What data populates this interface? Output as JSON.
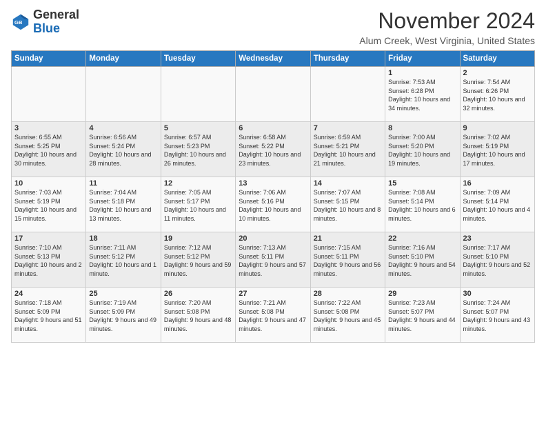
{
  "header": {
    "logo_general": "General",
    "logo_blue": "Blue",
    "title": "November 2024",
    "location": "Alum Creek, West Virginia, United States"
  },
  "days_of_week": [
    "Sunday",
    "Monday",
    "Tuesday",
    "Wednesday",
    "Thursday",
    "Friday",
    "Saturday"
  ],
  "weeks": [
    [
      {
        "day": "",
        "info": ""
      },
      {
        "day": "",
        "info": ""
      },
      {
        "day": "",
        "info": ""
      },
      {
        "day": "",
        "info": ""
      },
      {
        "day": "",
        "info": ""
      },
      {
        "day": "1",
        "info": "Sunrise: 7:53 AM\nSunset: 6:28 PM\nDaylight: 10 hours and 34 minutes."
      },
      {
        "day": "2",
        "info": "Sunrise: 7:54 AM\nSunset: 6:26 PM\nDaylight: 10 hours and 32 minutes."
      }
    ],
    [
      {
        "day": "3",
        "info": "Sunrise: 6:55 AM\nSunset: 5:25 PM\nDaylight: 10 hours and 30 minutes."
      },
      {
        "day": "4",
        "info": "Sunrise: 6:56 AM\nSunset: 5:24 PM\nDaylight: 10 hours and 28 minutes."
      },
      {
        "day": "5",
        "info": "Sunrise: 6:57 AM\nSunset: 5:23 PM\nDaylight: 10 hours and 26 minutes."
      },
      {
        "day": "6",
        "info": "Sunrise: 6:58 AM\nSunset: 5:22 PM\nDaylight: 10 hours and 23 minutes."
      },
      {
        "day": "7",
        "info": "Sunrise: 6:59 AM\nSunset: 5:21 PM\nDaylight: 10 hours and 21 minutes."
      },
      {
        "day": "8",
        "info": "Sunrise: 7:00 AM\nSunset: 5:20 PM\nDaylight: 10 hours and 19 minutes."
      },
      {
        "day": "9",
        "info": "Sunrise: 7:02 AM\nSunset: 5:19 PM\nDaylight: 10 hours and 17 minutes."
      }
    ],
    [
      {
        "day": "10",
        "info": "Sunrise: 7:03 AM\nSunset: 5:19 PM\nDaylight: 10 hours and 15 minutes."
      },
      {
        "day": "11",
        "info": "Sunrise: 7:04 AM\nSunset: 5:18 PM\nDaylight: 10 hours and 13 minutes."
      },
      {
        "day": "12",
        "info": "Sunrise: 7:05 AM\nSunset: 5:17 PM\nDaylight: 10 hours and 11 minutes."
      },
      {
        "day": "13",
        "info": "Sunrise: 7:06 AM\nSunset: 5:16 PM\nDaylight: 10 hours and 10 minutes."
      },
      {
        "day": "14",
        "info": "Sunrise: 7:07 AM\nSunset: 5:15 PM\nDaylight: 10 hours and 8 minutes."
      },
      {
        "day": "15",
        "info": "Sunrise: 7:08 AM\nSunset: 5:14 PM\nDaylight: 10 hours and 6 minutes."
      },
      {
        "day": "16",
        "info": "Sunrise: 7:09 AM\nSunset: 5:14 PM\nDaylight: 10 hours and 4 minutes."
      }
    ],
    [
      {
        "day": "17",
        "info": "Sunrise: 7:10 AM\nSunset: 5:13 PM\nDaylight: 10 hours and 2 minutes."
      },
      {
        "day": "18",
        "info": "Sunrise: 7:11 AM\nSunset: 5:12 PM\nDaylight: 10 hours and 1 minute."
      },
      {
        "day": "19",
        "info": "Sunrise: 7:12 AM\nSunset: 5:12 PM\nDaylight: 9 hours and 59 minutes."
      },
      {
        "day": "20",
        "info": "Sunrise: 7:13 AM\nSunset: 5:11 PM\nDaylight: 9 hours and 57 minutes."
      },
      {
        "day": "21",
        "info": "Sunrise: 7:15 AM\nSunset: 5:11 PM\nDaylight: 9 hours and 56 minutes."
      },
      {
        "day": "22",
        "info": "Sunrise: 7:16 AM\nSunset: 5:10 PM\nDaylight: 9 hours and 54 minutes."
      },
      {
        "day": "23",
        "info": "Sunrise: 7:17 AM\nSunset: 5:10 PM\nDaylight: 9 hours and 52 minutes."
      }
    ],
    [
      {
        "day": "24",
        "info": "Sunrise: 7:18 AM\nSunset: 5:09 PM\nDaylight: 9 hours and 51 minutes."
      },
      {
        "day": "25",
        "info": "Sunrise: 7:19 AM\nSunset: 5:09 PM\nDaylight: 9 hours and 49 minutes."
      },
      {
        "day": "26",
        "info": "Sunrise: 7:20 AM\nSunset: 5:08 PM\nDaylight: 9 hours and 48 minutes."
      },
      {
        "day": "27",
        "info": "Sunrise: 7:21 AM\nSunset: 5:08 PM\nDaylight: 9 hours and 47 minutes."
      },
      {
        "day": "28",
        "info": "Sunrise: 7:22 AM\nSunset: 5:08 PM\nDaylight: 9 hours and 45 minutes."
      },
      {
        "day": "29",
        "info": "Sunrise: 7:23 AM\nSunset: 5:07 PM\nDaylight: 9 hours and 44 minutes."
      },
      {
        "day": "30",
        "info": "Sunrise: 7:24 AM\nSunset: 5:07 PM\nDaylight: 9 hours and 43 minutes."
      }
    ]
  ]
}
